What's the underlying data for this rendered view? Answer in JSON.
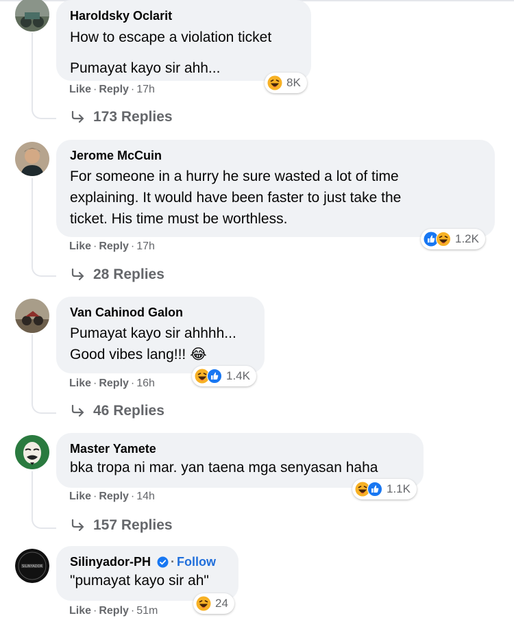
{
  "comments": [
    {
      "author": "Haroldsky Oclarit",
      "lines": [
        "How to escape a violation ticket",
        "Pumayat kayo sir ahh..."
      ],
      "like_label": "Like",
      "reply_label": "Reply",
      "time": "17h",
      "reactions": [
        "haha-icon"
      ],
      "reaction_count": "8K",
      "replies": "173 Replies"
    },
    {
      "author": "Jerome McCuin",
      "lines": [
        "For someone in a hurry he sure wasted a lot of time",
        "explaining. It would have been faster to just take the",
        "ticket. His time must be worthless."
      ],
      "like_label": "Like",
      "reply_label": "Reply",
      "time": "17h",
      "reactions": [
        "like-icon",
        "haha-icon"
      ],
      "reaction_count": "1.2K",
      "replies": "28 Replies"
    },
    {
      "author": "Van Cahinod Galon",
      "lines": [
        "Pumayat kayo sir ahhhh...",
        "Good vibes lang!!! 😂"
      ],
      "like_label": "Like",
      "reply_label": "Reply",
      "time": "16h",
      "reactions": [
        "haha-icon",
        "like-icon"
      ],
      "reaction_count": "1.4K",
      "replies": "46 Replies"
    },
    {
      "author": "Master Yamete",
      "lines": [
        "bka tropa ni mar. yan taena mga senyasan haha"
      ],
      "like_label": "Like",
      "reply_label": "Reply",
      "time": "14h",
      "reactions": [
        "haha-icon",
        "like-icon"
      ],
      "reaction_count": "1.1K",
      "replies": "157 Replies"
    },
    {
      "author": "Silinyador-PH",
      "follow_label": "Follow",
      "lines": [
        "\"pumayat kayo sir ah\""
      ],
      "like_label": "Like",
      "reply_label": "Reply",
      "time": "51m",
      "reactions": [
        "haha-icon"
      ],
      "reaction_count": "24"
    }
  ],
  "colors": {
    "bubble": "#f0f2f5",
    "secondary_text": "#65676b",
    "link_blue": "#216fdb",
    "like_blue": "#1877f2",
    "haha_yellow": "#f7b125"
  }
}
